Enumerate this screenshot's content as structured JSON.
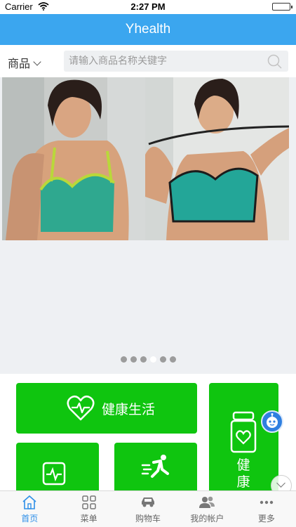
{
  "status_bar": {
    "carrier": "Carrier",
    "time": "2:27 PM"
  },
  "nav": {
    "title": "Yhealth"
  },
  "search": {
    "category": "商品",
    "placeholder": "请输入商品名称关键字"
  },
  "carousel": {
    "dots": 6,
    "active_dot": 3
  },
  "tiles": {
    "healthy_life": "健康生活",
    "healthy_diet": "健康饮"
  },
  "tabbar": {
    "items": [
      {
        "label": "首页",
        "icon": "home-icon",
        "active": true
      },
      {
        "label": "菜单",
        "icon": "menu-grid-icon",
        "active": false
      },
      {
        "label": "购物车",
        "icon": "car-icon",
        "active": false
      },
      {
        "label": "我的帐户",
        "icon": "users-icon",
        "active": false
      },
      {
        "label": "更多",
        "icon": "more-dots-icon",
        "active": false
      }
    ]
  },
  "colors": {
    "nav": "#3ba6ef",
    "tile": "#0fc50f",
    "tab_active": "#2f8fe8"
  }
}
